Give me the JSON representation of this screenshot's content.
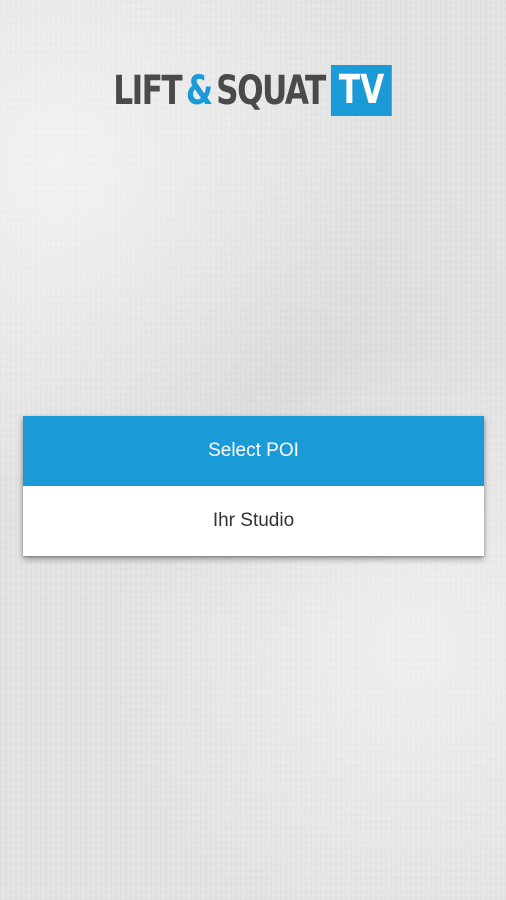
{
  "logo": {
    "word1": "LIFT",
    "amp": "&",
    "word2": "SQUAT",
    "tv": "TV"
  },
  "dialog": {
    "title": "Select POI",
    "items": [
      {
        "label": "Ihr Studio"
      }
    ]
  },
  "colors": {
    "accent": "#1a9ad6",
    "logo_text": "#4a4a4a",
    "background": "#e4e4e4"
  }
}
